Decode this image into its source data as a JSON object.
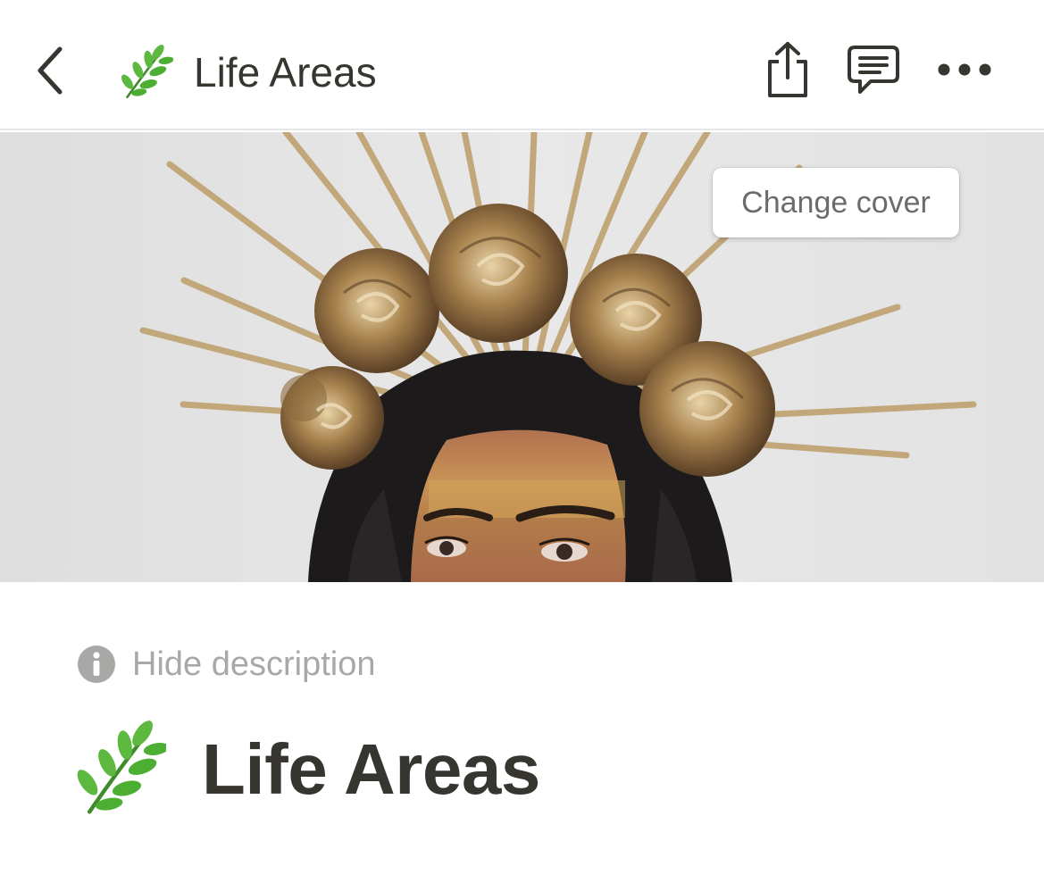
{
  "topbar": {
    "title": "Life Areas",
    "page_icon": "herb-emoji",
    "back_icon": "chevron-left-icon",
    "share_icon": "share-icon",
    "comment_icon": "comment-icon",
    "more_icon": "more-horizontal-icon"
  },
  "cover": {
    "change_cover_label": "Change cover",
    "image_subject": "woman wearing golden rose crown with radiating spikes"
  },
  "page": {
    "hide_description_label": "Hide description",
    "info_icon": "info-icon",
    "emoji": "herb-emoji",
    "title": "Life Areas"
  },
  "colors": {
    "text": "#37352f",
    "muted": "#a8a8a6",
    "button_text": "#6b6b6b",
    "leaf_green": "#4caf34"
  }
}
